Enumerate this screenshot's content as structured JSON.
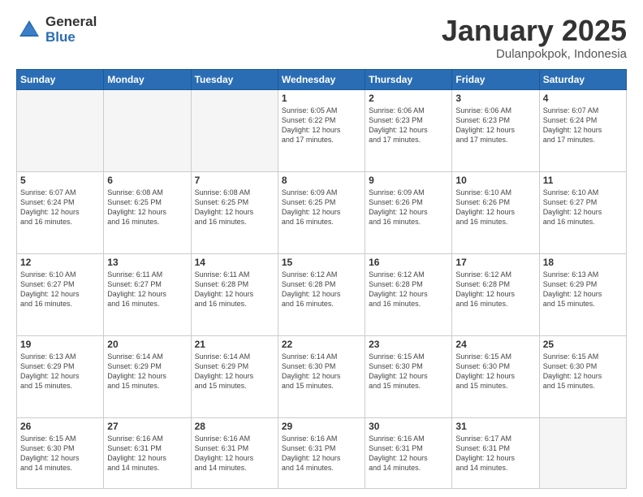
{
  "header": {
    "logo_general": "General",
    "logo_blue": "Blue",
    "title": "January 2025",
    "location": "Dulanpokpok, Indonesia"
  },
  "days_of_week": [
    "Sunday",
    "Monday",
    "Tuesday",
    "Wednesday",
    "Thursday",
    "Friday",
    "Saturday"
  ],
  "weeks": [
    [
      {
        "day": "",
        "info": ""
      },
      {
        "day": "",
        "info": ""
      },
      {
        "day": "",
        "info": ""
      },
      {
        "day": "1",
        "info": "Sunrise: 6:05 AM\nSunset: 6:22 PM\nDaylight: 12 hours\nand 17 minutes."
      },
      {
        "day": "2",
        "info": "Sunrise: 6:06 AM\nSunset: 6:23 PM\nDaylight: 12 hours\nand 17 minutes."
      },
      {
        "day": "3",
        "info": "Sunrise: 6:06 AM\nSunset: 6:23 PM\nDaylight: 12 hours\nand 17 minutes."
      },
      {
        "day": "4",
        "info": "Sunrise: 6:07 AM\nSunset: 6:24 PM\nDaylight: 12 hours\nand 17 minutes."
      }
    ],
    [
      {
        "day": "5",
        "info": "Sunrise: 6:07 AM\nSunset: 6:24 PM\nDaylight: 12 hours\nand 16 minutes."
      },
      {
        "day": "6",
        "info": "Sunrise: 6:08 AM\nSunset: 6:25 PM\nDaylight: 12 hours\nand 16 minutes."
      },
      {
        "day": "7",
        "info": "Sunrise: 6:08 AM\nSunset: 6:25 PM\nDaylight: 12 hours\nand 16 minutes."
      },
      {
        "day": "8",
        "info": "Sunrise: 6:09 AM\nSunset: 6:25 PM\nDaylight: 12 hours\nand 16 minutes."
      },
      {
        "day": "9",
        "info": "Sunrise: 6:09 AM\nSunset: 6:26 PM\nDaylight: 12 hours\nand 16 minutes."
      },
      {
        "day": "10",
        "info": "Sunrise: 6:10 AM\nSunset: 6:26 PM\nDaylight: 12 hours\nand 16 minutes."
      },
      {
        "day": "11",
        "info": "Sunrise: 6:10 AM\nSunset: 6:27 PM\nDaylight: 12 hours\nand 16 minutes."
      }
    ],
    [
      {
        "day": "12",
        "info": "Sunrise: 6:10 AM\nSunset: 6:27 PM\nDaylight: 12 hours\nand 16 minutes."
      },
      {
        "day": "13",
        "info": "Sunrise: 6:11 AM\nSunset: 6:27 PM\nDaylight: 12 hours\nand 16 minutes."
      },
      {
        "day": "14",
        "info": "Sunrise: 6:11 AM\nSunset: 6:28 PM\nDaylight: 12 hours\nand 16 minutes."
      },
      {
        "day": "15",
        "info": "Sunrise: 6:12 AM\nSunset: 6:28 PM\nDaylight: 12 hours\nand 16 minutes."
      },
      {
        "day": "16",
        "info": "Sunrise: 6:12 AM\nSunset: 6:28 PM\nDaylight: 12 hours\nand 16 minutes."
      },
      {
        "day": "17",
        "info": "Sunrise: 6:12 AM\nSunset: 6:28 PM\nDaylight: 12 hours\nand 16 minutes."
      },
      {
        "day": "18",
        "info": "Sunrise: 6:13 AM\nSunset: 6:29 PM\nDaylight: 12 hours\nand 15 minutes."
      }
    ],
    [
      {
        "day": "19",
        "info": "Sunrise: 6:13 AM\nSunset: 6:29 PM\nDaylight: 12 hours\nand 15 minutes."
      },
      {
        "day": "20",
        "info": "Sunrise: 6:14 AM\nSunset: 6:29 PM\nDaylight: 12 hours\nand 15 minutes."
      },
      {
        "day": "21",
        "info": "Sunrise: 6:14 AM\nSunset: 6:29 PM\nDaylight: 12 hours\nand 15 minutes."
      },
      {
        "day": "22",
        "info": "Sunrise: 6:14 AM\nSunset: 6:30 PM\nDaylight: 12 hours\nand 15 minutes."
      },
      {
        "day": "23",
        "info": "Sunrise: 6:15 AM\nSunset: 6:30 PM\nDaylight: 12 hours\nand 15 minutes."
      },
      {
        "day": "24",
        "info": "Sunrise: 6:15 AM\nSunset: 6:30 PM\nDaylight: 12 hours\nand 15 minutes."
      },
      {
        "day": "25",
        "info": "Sunrise: 6:15 AM\nSunset: 6:30 PM\nDaylight: 12 hours\nand 15 minutes."
      }
    ],
    [
      {
        "day": "26",
        "info": "Sunrise: 6:15 AM\nSunset: 6:30 PM\nDaylight: 12 hours\nand 14 minutes."
      },
      {
        "day": "27",
        "info": "Sunrise: 6:16 AM\nSunset: 6:31 PM\nDaylight: 12 hours\nand 14 minutes."
      },
      {
        "day": "28",
        "info": "Sunrise: 6:16 AM\nSunset: 6:31 PM\nDaylight: 12 hours\nand 14 minutes."
      },
      {
        "day": "29",
        "info": "Sunrise: 6:16 AM\nSunset: 6:31 PM\nDaylight: 12 hours\nand 14 minutes."
      },
      {
        "day": "30",
        "info": "Sunrise: 6:16 AM\nSunset: 6:31 PM\nDaylight: 12 hours\nand 14 minutes."
      },
      {
        "day": "31",
        "info": "Sunrise: 6:17 AM\nSunset: 6:31 PM\nDaylight: 12 hours\nand 14 minutes."
      },
      {
        "day": "",
        "info": ""
      }
    ]
  ]
}
